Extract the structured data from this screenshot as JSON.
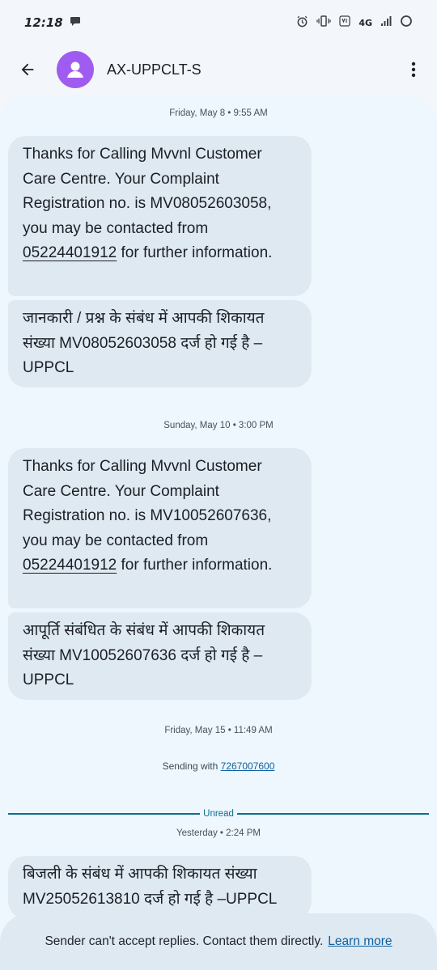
{
  "status_bar": {
    "time": "12:18",
    "network": "4G"
  },
  "header": {
    "title": "AX-UPPCLT-S"
  },
  "conversation": {
    "timestamps": [
      "Friday, May 8 • 9:55 AM",
      "Sunday, May 10 • 3:00 PM",
      "Friday, May 15 • 11:49 AM",
      "Yesterday • 2:24 PM"
    ],
    "messages": [
      {
        "pre": "Thanks for Calling Mvvnl Customer Care Centre. Your Complaint Registration no. is MV08052603058, you may be contacted from ",
        "phone": "05224401912",
        "post": "  for further information."
      },
      {
        "text": "जानकारी / प्रश्न के संबंध में आपकी शिकायत संख्या MV08052603058 दर्ज हो गई है –UPPCL"
      },
      {
        "pre": "Thanks for Calling Mvvnl Customer Care Centre. Your Complaint Registration no. is MV10052607636, you may be contacted from ",
        "phone": "05224401912",
        "post": "  for further information."
      },
      {
        "text": "आपूर्ति संबंधित के संबंध में आपकी शिकायत संख्या MV10052607636 दर्ज हो गई है –UPPCL"
      },
      {
        "text": "बिजली के संबंध में आपकी शिकायत संख्या MV25052613810 दर्ज हो गई है –UPPCL"
      }
    ],
    "sending_label": "Sending with ",
    "sending_number": "7267007600",
    "unread_label": "Unread"
  },
  "footer": {
    "text": "Sender can't accept replies. Contact them directly.",
    "link": "Learn more"
  },
  "colors": {
    "avatar": "#a05cf0",
    "bubble": "#dfe9f2",
    "accent": "#0d6d8f"
  }
}
